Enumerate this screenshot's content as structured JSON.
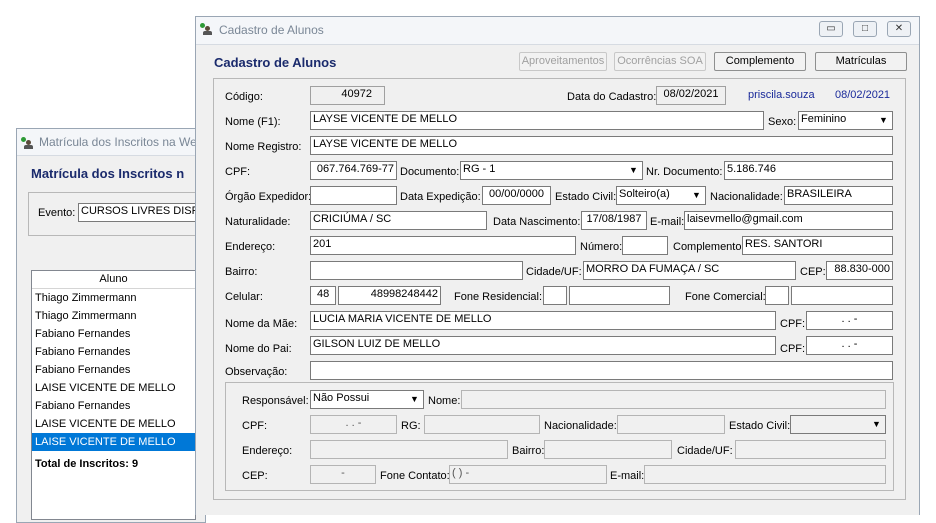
{
  "back_window": {
    "title": "Matrícula dos Inscritos na We",
    "heading": "Matrícula dos Inscritos n",
    "evento_label": "Evento:",
    "evento_value": "CURSOS LIVRES DISP",
    "list_header": "Aluno",
    "students": [
      "Thiago Zimmermann",
      "Thiago Zimmermann",
      "Fabiano Fernandes",
      "Fabiano Fernandes",
      "Fabiano Fernandes",
      "LAISE VICENTE DE MELLO",
      "Fabiano Fernandes",
      "LAISE VICENTE DE MELLO",
      "LAISE VICENTE DE MELLO"
    ],
    "selected_index": 8,
    "total": "Total de Inscritos: 9"
  },
  "window": {
    "title": "Cadastro de Alunos",
    "heading": "Cadastro de Alunos",
    "controls": {
      "minimize": "▭",
      "maximize": "□",
      "close": "✕"
    },
    "buttons": {
      "aproveitamentos": "Aproveitamentos",
      "ocorrencias": "Ocorrências SOA",
      "complemento": "Complemento",
      "matriculas": "Matrículas"
    }
  },
  "form": {
    "codigo": {
      "label": "Código:",
      "value": "40972"
    },
    "data_cadastro": {
      "label": "Data do Cadastro:",
      "value": "08/02/2021"
    },
    "user": "priscila.souza",
    "user_date": "08/02/2021",
    "nome": {
      "label": "Nome (F1):",
      "value": "LAYSE VICENTE DE MELLO"
    },
    "sexo": {
      "label": "Sexo:",
      "value": "Feminino"
    },
    "nome_registro": {
      "label": "Nome Registro:",
      "value": "LAYSE VICENTE DE MELLO"
    },
    "cpf": {
      "label": "CPF:",
      "value": "067.764.769-77"
    },
    "documento": {
      "label": "Documento:",
      "value": "RG - 1"
    },
    "nr_documento": {
      "label": "Nr. Documento:",
      "value": "5.186.746"
    },
    "orgao_expedidor": {
      "label": "Órgão Expedidor:",
      "value": ""
    },
    "data_expedicao": {
      "label": "Data Expedição:",
      "value": "00/00/0000"
    },
    "estado_civil": {
      "label": "Estado Civil:",
      "value": "Solteiro(a)"
    },
    "nacionalidade": {
      "label": "Nacionalidade:",
      "value": "BRASILEIRA"
    },
    "naturalidade": {
      "label": "Naturalidade:",
      "value": "CRICIÚMA / SC"
    },
    "data_nascimento": {
      "label": "Data Nascimento:",
      "value": "17/08/1987"
    },
    "email": {
      "label": "E-mail:",
      "value": "laisevmello@gmail.com"
    },
    "endereco": {
      "label": "Endereço:",
      "value": "201"
    },
    "numero": {
      "label": "Número:",
      "value": ""
    },
    "complemento": {
      "label": "Complemento:",
      "value": "RES. SANTORI"
    },
    "bairro": {
      "label": "Bairro:",
      "value": ""
    },
    "cidade_uf": {
      "label": "Cidade/UF:",
      "value": "MORRO DA FUMAÇA / SC"
    },
    "cep": {
      "label": "CEP:",
      "value": "88.830-000"
    },
    "celular": {
      "label": "Celular:",
      "ddd": "48",
      "value": "48998248442"
    },
    "fone_residencial": {
      "label": "Fone Residencial:",
      "ddd": "",
      "value": ""
    },
    "fone_comercial": {
      "label": "Fone Comercial:",
      "ddd": "",
      "value": ""
    },
    "nome_mae": {
      "label": "Nome da Mãe:",
      "value": "LUCIA MARIA VICENTE DE MELLO"
    },
    "cpf_mae": {
      "label": "CPF:",
      "value": ". . -"
    },
    "nome_pai": {
      "label": "Nome do Pai:",
      "value": "GILSON LUIZ DE MELLO"
    },
    "cpf_pai": {
      "label": "CPF:",
      "value": ". . -"
    },
    "observacao": {
      "label": "Observação:",
      "value": ""
    }
  },
  "responsavel": {
    "responsavel": {
      "label": "Responsável:",
      "value": "Não Possui"
    },
    "nome": {
      "label": "Nome:",
      "value": ""
    },
    "cpf": {
      "label": "CPF:",
      "value": ". . -"
    },
    "rg": {
      "label": "RG:",
      "value": ""
    },
    "nacionalidade": {
      "label": "Nacionalidade:",
      "value": ""
    },
    "estado_civil": {
      "label": "Estado Civil:",
      "value": ""
    },
    "endereco": {
      "label": "Endereço:",
      "value": ""
    },
    "bairro": {
      "label": "Bairro:",
      "value": ""
    },
    "cidade_uf": {
      "label": "Cidade/UF:",
      "value": ""
    },
    "cep": {
      "label": "CEP:",
      "value": "-"
    },
    "fone_contato": {
      "label": "Fone Contato:",
      "value": "( ) -"
    },
    "email": {
      "label": "E-mail:",
      "value": ""
    }
  }
}
